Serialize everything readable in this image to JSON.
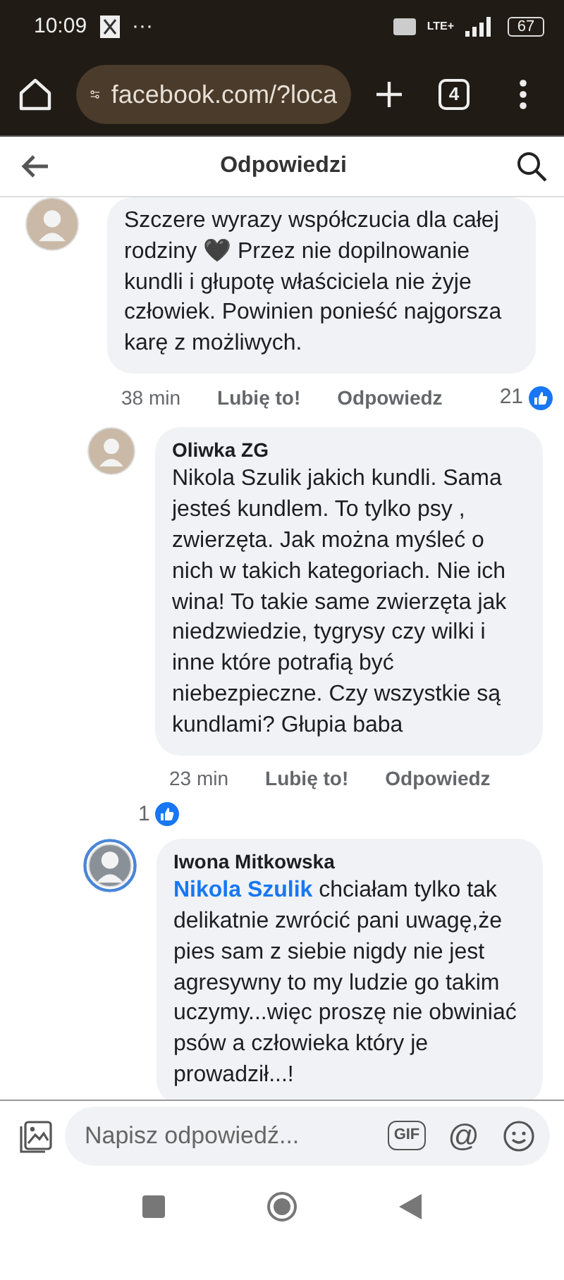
{
  "status_bar": {
    "time": "10:09",
    "more": "···",
    "network": "LTE+",
    "battery": "67"
  },
  "browser": {
    "url": "facebook.com/?loca",
    "tab_count": "4"
  },
  "header": {
    "title": "Odpowiedzi"
  },
  "comments": [
    {
      "text": "Szczere wyrazy współczucia dla całej rodziny 🖤 Przez nie dopilnowanie kundli i głupotę właściciela nie żyje człowiek. Powinien ponieść najgorsza karę z możliwych.",
      "time": "38 min",
      "like": "Lubię to!",
      "reply": "Odpowiedz",
      "reactions": "21",
      "story_ring": false,
      "children": [
        {
          "author": "Oliwka ZG",
          "text": "Nikola Szulik jakich kundli. Sama jesteś kundlem. To tylko psy , zwierzęta. Jak można myśleć o nich w takich kategoriach. Nie ich wina! To takie same zwierzęta jak niedzwiedzie, tygrysy czy wilki i inne które potrafią być niebezpieczne. Czy wszystkie są kundlami? Głupia baba",
          "time": "23 min",
          "like": "Lubię to!",
          "reply": "Odpowiedz",
          "reactions": "1",
          "story_ring": false
        },
        {
          "author": "Iwona Mitkowska",
          "mention": "Nikola Szulik",
          "text": " chciałam tylko tak delikatnie zwrócić pani uwagę,że pies sam z siebie nigdy nie jest agresywny to my ludzie go takim uczymy...więc proszę nie obwiniać psów a człowieka który je prowadził...!",
          "story_ring": true
        }
      ]
    }
  ],
  "composer": {
    "placeholder": "Napisz odpowiedź...",
    "gif": "GIF",
    "mention": "@"
  }
}
